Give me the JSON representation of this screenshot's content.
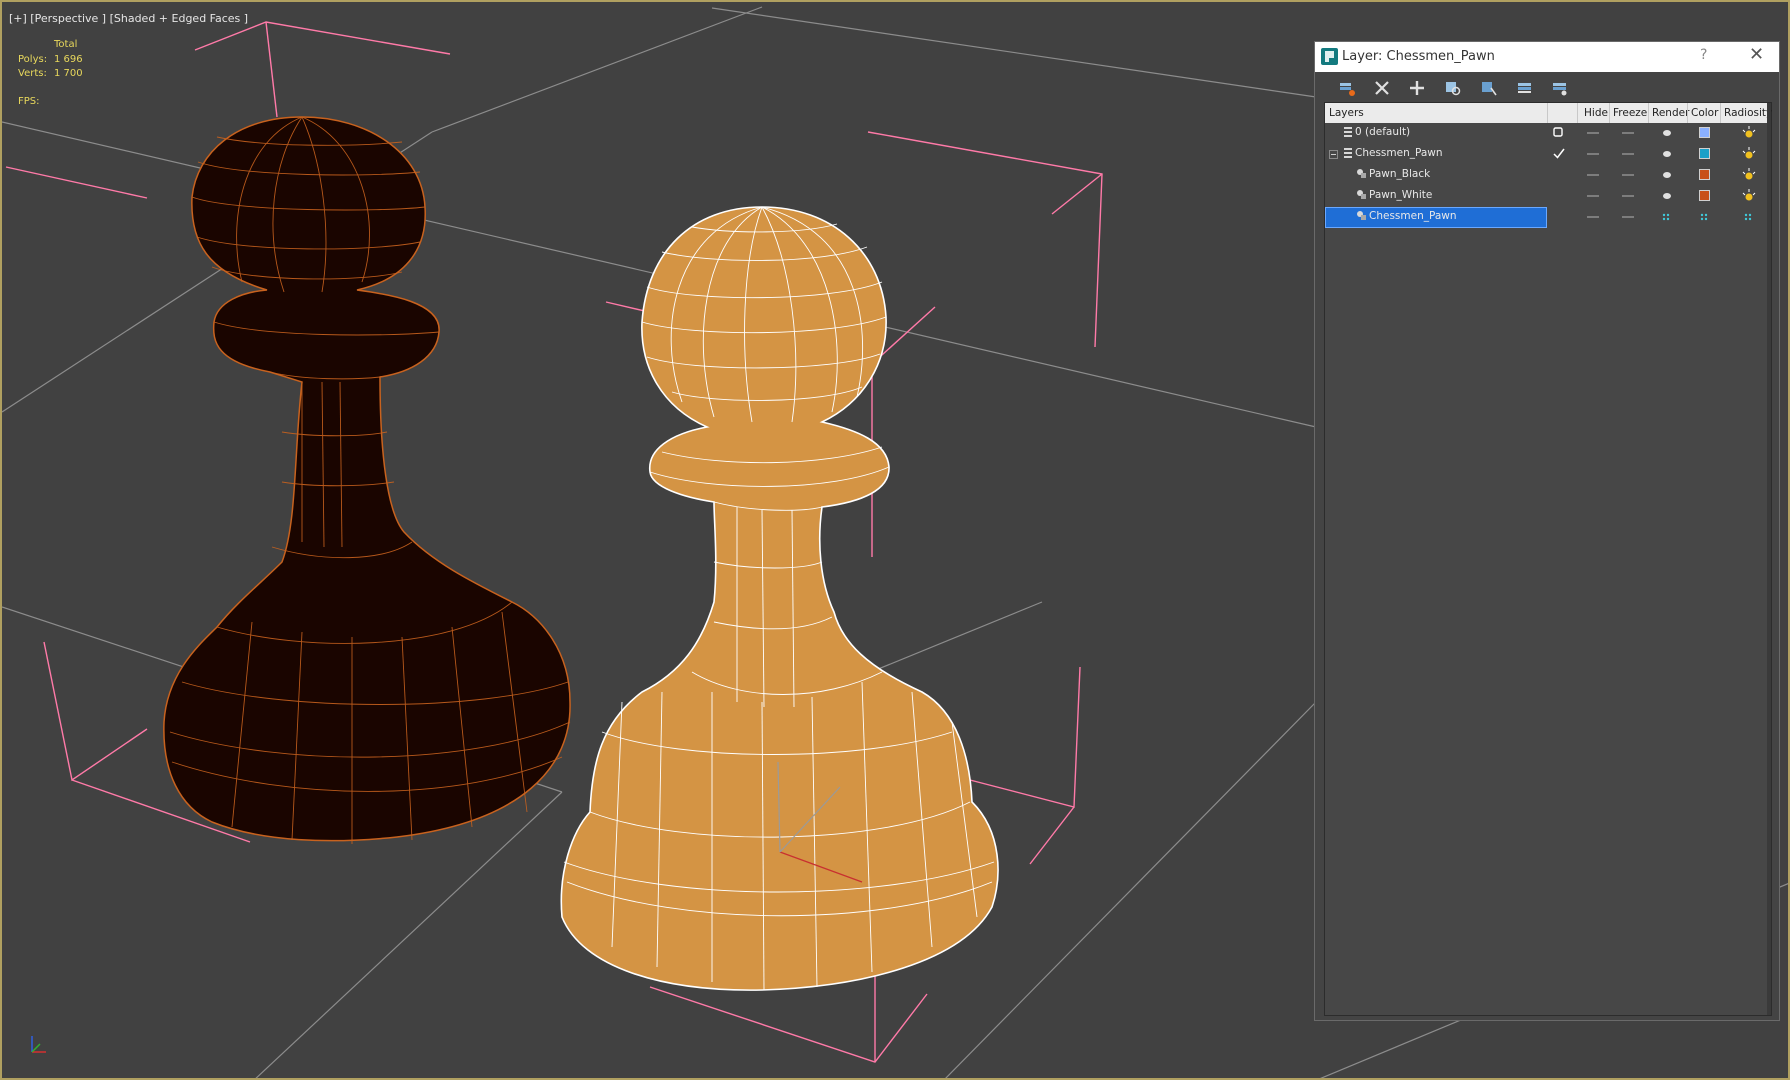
{
  "viewport": {
    "label": "[+] [Perspective ] [Shaded + Edged Faces ]",
    "stats": {
      "total_label": "Total",
      "polys_label": "Polys:",
      "polys_value": "1 696",
      "verts_label": "Verts:",
      "verts_value": "1 700",
      "fps_label": "FPS:"
    },
    "objects": [
      "Pawn_Black",
      "Pawn_White"
    ],
    "colors": {
      "background": "#414141",
      "pawn_black_fill": "#1a0500",
      "pawn_black_wire": "#c8621e",
      "pawn_white_fill": "#d49444",
      "pawn_white_wire": "#ffffff",
      "bbox": "#ff7aa8",
      "grid": "#909090"
    }
  },
  "dialog": {
    "title": "Layer: Chessmen_Pawn",
    "help": "?",
    "close": "✕",
    "toolbar": [
      "create-new-layer-icon",
      "delete-layer-icon",
      "add-to-layer-icon",
      "select-objects-icon",
      "highlight-layer-icon",
      "hide-all-icon",
      "freeze-all-icon"
    ],
    "columns": {
      "layers": "Layers",
      "hide": "Hide",
      "freeze": "Freeze",
      "render": "Render",
      "color": "Color",
      "radiosity": "Radiosity"
    },
    "rows": [
      {
        "name": "0 (default)",
        "indent": 0,
        "color": "#8ab0ff"
      },
      {
        "name": "Chessmen_Pawn",
        "indent": 0,
        "color": "#1aa0c8"
      },
      {
        "name": "Pawn_Black",
        "indent": 1,
        "color": "#c85018"
      },
      {
        "name": "Pawn_White",
        "indent": 1,
        "color": "#c85018"
      },
      {
        "name": "Chessmen_Pawn",
        "indent": 1,
        "color": ""
      }
    ],
    "selected_row": 4
  }
}
